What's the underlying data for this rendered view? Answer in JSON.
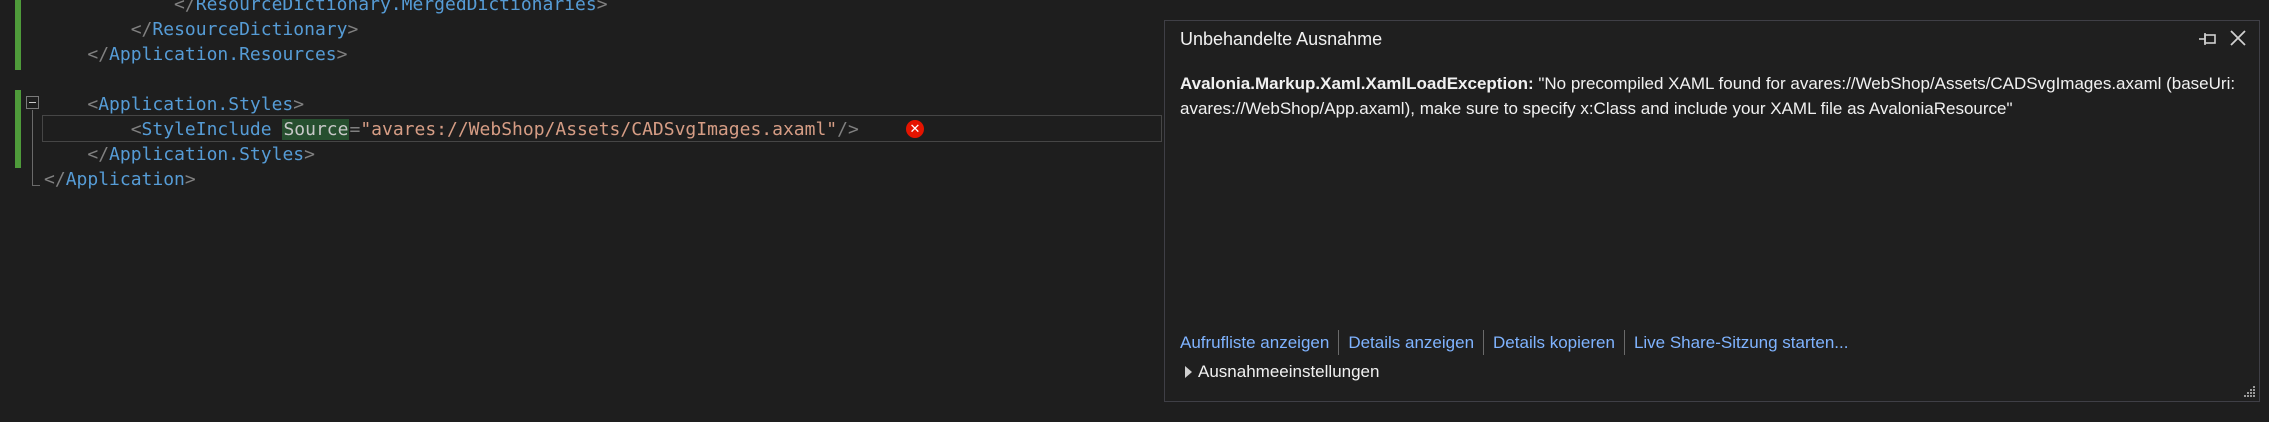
{
  "editor": {
    "lines": [
      {
        "indent": "            ",
        "parts": [
          [
            "lt",
            "</"
          ],
          [
            "tag",
            "ResourceDictionary.MergedDictionaries"
          ],
          [
            "lt",
            ">"
          ]
        ]
      },
      {
        "indent": "        ",
        "parts": [
          [
            "lt",
            "</"
          ],
          [
            "tag",
            "ResourceDictionary"
          ],
          [
            "lt",
            ">"
          ]
        ]
      },
      {
        "indent": "    ",
        "parts": [
          [
            "lt",
            "</"
          ],
          [
            "tag",
            "Application.Resources"
          ],
          [
            "lt",
            ">"
          ]
        ]
      },
      {
        "indent": "",
        "parts": []
      },
      {
        "indent": "    ",
        "parts": [
          [
            "lt",
            "<"
          ],
          [
            "tag",
            "Application.Styles"
          ],
          [
            "lt",
            ">"
          ]
        ]
      },
      {
        "indent": "        ",
        "parts": [
          [
            "lt",
            "<"
          ],
          [
            "tag",
            "StyleInclude"
          ],
          [
            "plain",
            " "
          ],
          [
            "hl-attr",
            "Source"
          ],
          [
            "lt",
            "="
          ],
          [
            "str",
            "\"avares://WebShop/Assets/CADSvgImages.axaml\""
          ],
          [
            "lt",
            "/>"
          ]
        ]
      },
      {
        "indent": "    ",
        "parts": [
          [
            "lt",
            "</"
          ],
          [
            "tag",
            "Application.Styles"
          ],
          [
            "lt",
            ">"
          ]
        ]
      },
      {
        "indent": "",
        "parts": [
          [
            "lt",
            "</"
          ],
          [
            "tag",
            "Application"
          ],
          [
            "lt",
            ">"
          ]
        ]
      }
    ],
    "error_icon": "error-x-icon"
  },
  "popup": {
    "title": "Unbehandelte Ausnahme",
    "exception_type": "Avalonia.Markup.Xaml.XamlLoadException:",
    "message": " \"No precompiled XAML found for avares://WebShop/Assets/CADSvgImages.axaml (baseUri: avares://WebShop/App.axaml), make sure to specify x:Class and include your XAML file as AvaloniaResource\"",
    "links": [
      "Aufrufliste anzeigen",
      "Details anzeigen",
      "Details kopieren",
      "Live Share-Sitzung starten..."
    ],
    "settings_label": "Ausnahmeeinstellungen"
  }
}
